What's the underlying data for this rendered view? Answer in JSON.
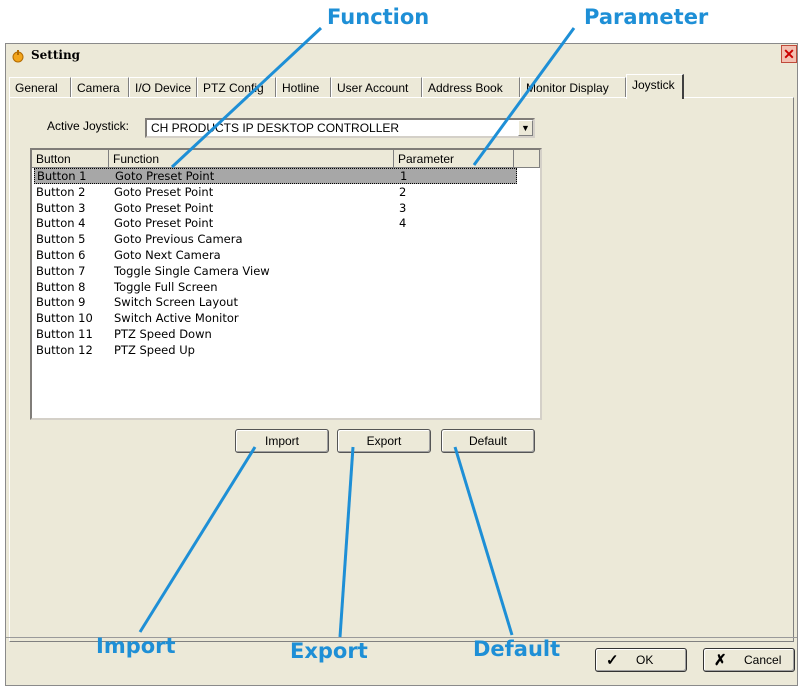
{
  "callouts": {
    "function": "Function",
    "parameter": "Parameter",
    "import": "Import",
    "export": "Export",
    "default": "Default"
  },
  "window": {
    "title": "Setting"
  },
  "tabs": [
    "General",
    "Camera",
    "I/O Device",
    "PTZ Config",
    "Hotline",
    "User Account",
    "Address Book",
    "Monitor Display",
    "Joystick"
  ],
  "active_tab": "Joystick",
  "joystick": {
    "label": "Active Joystick:",
    "value": "CH PRODUCTS IP DESKTOP CONTROLLER"
  },
  "table": {
    "columns": [
      "Button",
      "Function",
      "Parameter"
    ],
    "rows": [
      [
        "Button 1",
        "Goto Preset Point",
        "1"
      ],
      [
        "Button 2",
        "Goto Preset Point",
        "2"
      ],
      [
        "Button 3",
        "Goto Preset Point",
        "3"
      ],
      [
        "Button 4",
        "Goto Preset Point",
        "4"
      ],
      [
        "Button 5",
        "Goto Previous Camera",
        ""
      ],
      [
        "Button 6",
        "Goto Next Camera",
        ""
      ],
      [
        "Button 7",
        "Toggle Single Camera View",
        ""
      ],
      [
        "Button 8",
        "Toggle Full Screen",
        ""
      ],
      [
        "Button 9",
        "Switch Screen Layout",
        ""
      ],
      [
        "Button 10",
        "Switch Active Monitor",
        ""
      ],
      [
        "Button 11",
        "PTZ Speed Down",
        ""
      ],
      [
        "Button 12",
        "PTZ Speed Up",
        ""
      ]
    ],
    "selected_row": 0
  },
  "buttons": {
    "import": "Import",
    "export": "Export",
    "default": "Default",
    "ok": "OK",
    "cancel": "Cancel"
  },
  "colors": {
    "callout": "#1e8fd6",
    "dialog_bg": "#ece9d8",
    "selection": "#a7a7a7"
  },
  "icons": {
    "app": "app-icon",
    "close": "close-icon",
    "ok": "checkmark-icon",
    "cancel": "x-icon",
    "dropdown": "chevron-down-icon"
  }
}
